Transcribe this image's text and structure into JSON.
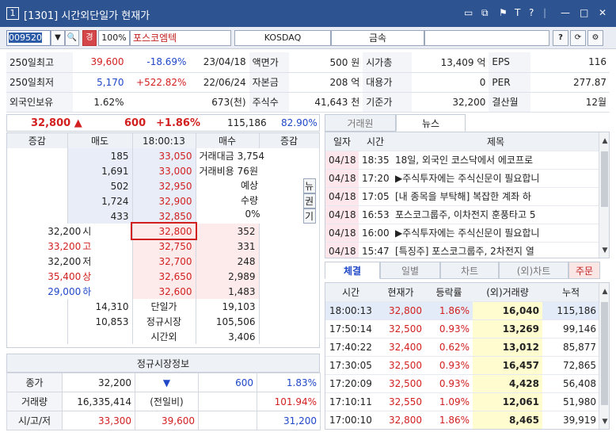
{
  "window": {
    "number": "1",
    "title": "[1301] 시간외단일가 현재가",
    "icons": [
      "layout-icon",
      "window-icon",
      "pin-icon",
      "font-icon",
      "help-icon",
      "minimize-icon",
      "maximize-icon",
      "close-icon"
    ]
  },
  "toolbar": {
    "code": "009520",
    "warn_badge": "경",
    "margin": "100%",
    "name": "포스코엠텍",
    "market": "KOSDAQ",
    "sector": "금속",
    "help": "?"
  },
  "info": {
    "rows": [
      [
        "250일최고",
        "39,600",
        "-18.69%",
        "23/04/18",
        "액면가",
        "500 원",
        "시가총",
        "13,409 억",
        "EPS",
        "116"
      ],
      [
        "250일최저",
        "5,170",
        "+522.82%",
        "22/06/24",
        "자본금",
        "208 억",
        "대용가",
        "0",
        "PER",
        "277.87"
      ],
      [
        "외국인보유",
        "1.62%",
        "",
        "673(천)",
        "주식수",
        "41,643 천",
        "기준가",
        "32,200",
        "결산월",
        "12월"
      ]
    ]
  },
  "summary": {
    "price": "32,800 ▲",
    "change": "600",
    "rate": "+1.86%",
    "volume": "115,186",
    "strength": "82.90%"
  },
  "orderbook": {
    "headers": [
      "증감",
      "매도",
      "18:00:13",
      "매수",
      "증감"
    ],
    "asks": [
      {
        "qty": "185",
        "price": "33,050"
      },
      {
        "qty": "1,691",
        "price": "33,000"
      },
      {
        "qty": "502",
        "price": "32,950"
      },
      {
        "qty": "1,724",
        "price": "32,900"
      },
      {
        "qty": "433",
        "price": "32,850"
      }
    ],
    "ask_info": [
      {
        "label": "거래대금",
        "value": "3,754"
      },
      {
        "label": "거래비용",
        "value": "76원"
      },
      {
        "label": "예상",
        "value": ""
      },
      {
        "label": "수량",
        "value": ""
      },
      {
        "label": "",
        "value": "0%"
      }
    ],
    "side_btns": [
      "뉴",
      "권",
      "기"
    ],
    "bids": [
      {
        "label": "32,200",
        "tag": "시",
        "price": "32,800",
        "qty": "352"
      },
      {
        "label": "33,200",
        "tag": "고",
        "price": "32,750",
        "qty": "331"
      },
      {
        "label": "32,200",
        "tag": "저",
        "price": "32,700",
        "qty": "248"
      },
      {
        "label": "35,400",
        "tag": "상",
        "price": "32,650",
        "qty": "2,989"
      },
      {
        "label": "29,000",
        "tag": "하",
        "price": "32,600",
        "qty": "1,483"
      }
    ],
    "totals": [
      {
        "left": "14,310",
        "mid": "단일가",
        "right": "19,103"
      },
      {
        "left": "10,853",
        "mid": "정규시장",
        "right": "105,506"
      },
      {
        "left": "",
        "mid": "시간외",
        "right": "3,406"
      }
    ]
  },
  "regular": {
    "title": "정규시장정보",
    "rows": [
      {
        "label": "종가",
        "a": "32,200",
        "b": "▼",
        "c": "600",
        "d": "1.83%"
      },
      {
        "label": "거래량",
        "a": "16,335,414",
        "b": "(전일비)",
        "c": "",
        "d": "101.94%"
      },
      {
        "label": "시/고/저",
        "a": "33,300",
        "b": "39,600",
        "c": "",
        "d": "31,200"
      }
    ]
  },
  "news_tabs": [
    "거래원",
    "뉴스"
  ],
  "news": {
    "headers": [
      "일자",
      "시간",
      "제목"
    ],
    "rows": [
      [
        "04/18",
        "18:35",
        "18일, 외국인 코스닥에서 에코프로"
      ],
      [
        "04/18",
        "17:20",
        "▶주식투자에는 주식신문이 필요합니"
      ],
      [
        "04/18",
        "17:05",
        "[내 종목을 부탁해] 복잡한 계좌 하"
      ],
      [
        "04/18",
        "16:53",
        "포스코그룹주, 이차전지 훈풍타고 5"
      ],
      [
        "04/18",
        "16:00",
        "▶주식투자에는 주식신문이 필요합니"
      ],
      [
        "04/18",
        "15:47",
        "[특징주] 포스코그룹주, 2차전지 열"
      ]
    ]
  },
  "tick_tabs": [
    "체결",
    "일별",
    "차트",
    "(외)차트",
    "주문"
  ],
  "ticks": {
    "headers": [
      "시간",
      "현재가",
      "등락률",
      "(외)거래량",
      "누적"
    ],
    "rows": [
      [
        "18:00:13",
        "32,800",
        "1.86%",
        "16,040",
        "115,186"
      ],
      [
        "17:50:14",
        "32,500",
        "0.93%",
        "13,269",
        "99,146"
      ],
      [
        "17:40:22",
        "32,400",
        "0.62%",
        "13,012",
        "85,877"
      ],
      [
        "17:30:05",
        "32,500",
        "0.93%",
        "16,457",
        "72,865"
      ],
      [
        "17:20:09",
        "32,500",
        "0.93%",
        "4,428",
        "56,408"
      ],
      [
        "17:10:11",
        "32,550",
        "1.09%",
        "12,061",
        "51,980"
      ],
      [
        "17:00:10",
        "32,800",
        "1.86%",
        "8,465",
        "39,919"
      ]
    ]
  }
}
